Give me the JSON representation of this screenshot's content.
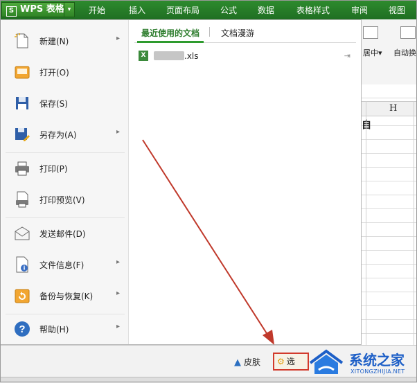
{
  "app": {
    "title": "WPS 表格",
    "logo_char": "S",
    "caret": "▾"
  },
  "ribbon_tabs": [
    "开始",
    "插入",
    "页面布局",
    "公式",
    "数据",
    "表格样式",
    "审阅",
    "视图"
  ],
  "toolbar": {
    "merge_center_label": "居中",
    "merge_center_caret": "▾",
    "auto_wrap_label": "自动换"
  },
  "sheet": {
    "visible_column": "H",
    "cut_off_char": "自"
  },
  "file_menu": {
    "items": [
      {
        "label": "新建(N)",
        "icon": "new-document-icon",
        "has_submenu": true
      },
      {
        "label": "打开(O)",
        "icon": "open-folder-icon",
        "has_submenu": false
      },
      {
        "label": "保存(S)",
        "icon": "save-disk-icon",
        "has_submenu": false
      },
      {
        "label": "另存为(A)",
        "icon": "save-as-icon",
        "has_submenu": true
      },
      {
        "label": "打印(P)",
        "icon": "printer-icon",
        "has_submenu": false
      },
      {
        "label": "打印预览(V)",
        "icon": "print-preview-icon",
        "has_submenu": false
      },
      {
        "label": "发送邮件(D)",
        "icon": "envelope-icon",
        "has_submenu": false
      },
      {
        "label": "文件信息(F)",
        "icon": "file-info-icon",
        "has_submenu": true
      },
      {
        "label": "备份与恢复(K)",
        "icon": "backup-restore-icon",
        "has_submenu": true
      },
      {
        "label": "帮助(H)",
        "icon": "help-icon",
        "has_submenu": true
      }
    ],
    "submenu_arrow": "▸",
    "right_tabs": [
      {
        "label": "最近使用的文档",
        "active": true
      },
      {
        "label": "文档漫游",
        "active": false
      }
    ],
    "recent_files": [
      {
        "name": ".xls",
        "icon": "xls-file-icon",
        "pin": "⇥"
      }
    ]
  },
  "bottom_bar": {
    "skin_label": "皮肤",
    "options_label": "选",
    "highlight_color": "#d23a2c"
  },
  "watermark": {
    "title": "系统之家",
    "subtitle": "XITONGZHIJIA.NET"
  },
  "colors": {
    "ribbon_green": "#2e8c2e",
    "accent_green": "#2e9b2e",
    "arrow_red": "#c0392b",
    "watermark_blue": "#1d5fc7"
  }
}
